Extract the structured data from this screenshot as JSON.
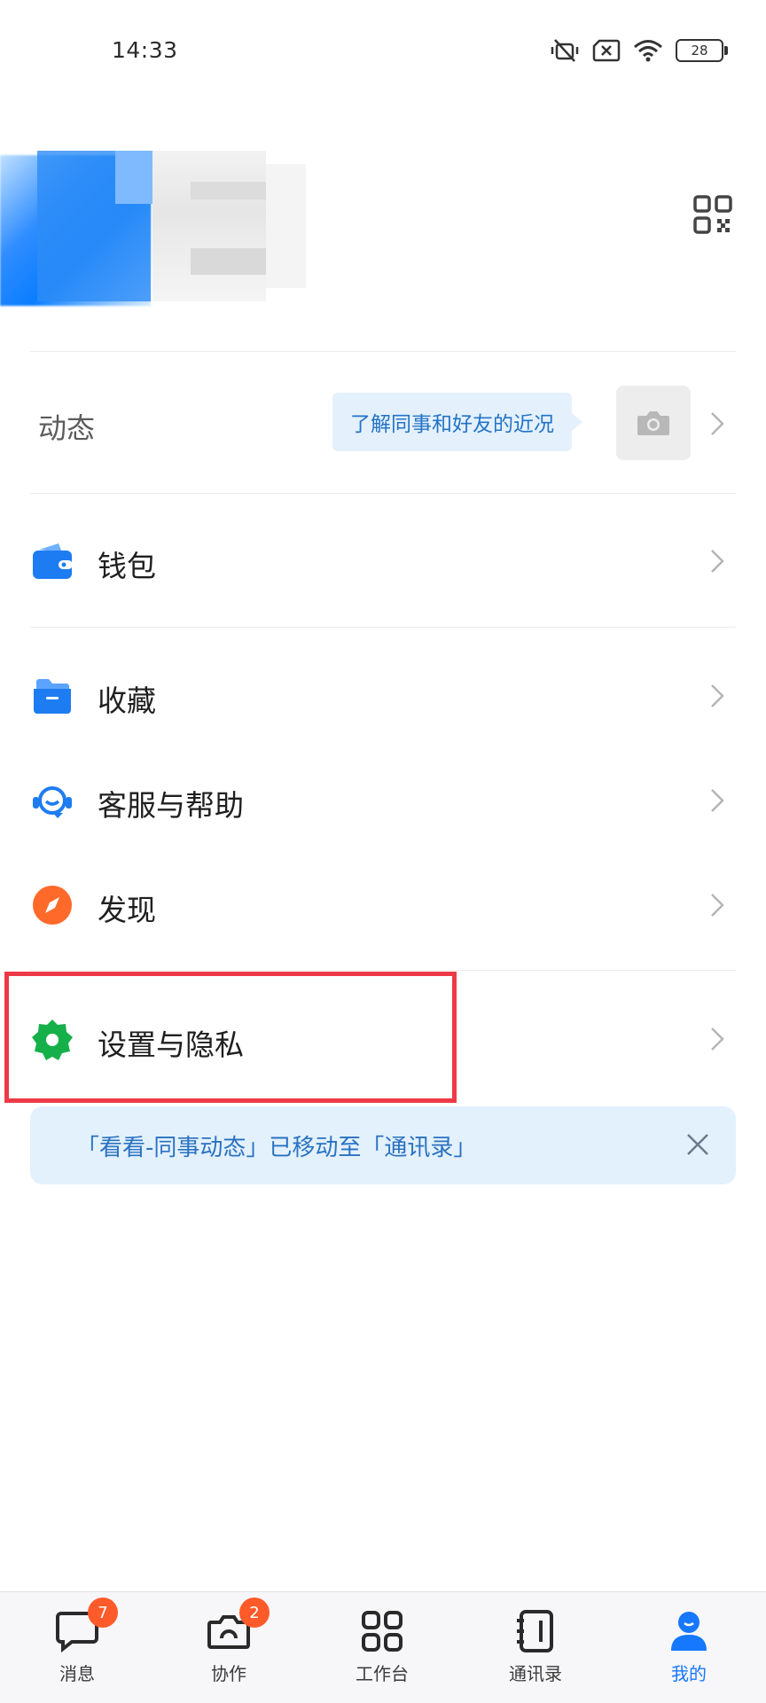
{
  "status_bar": {
    "time": "14:33",
    "battery": "28"
  },
  "feed": {
    "label": "动态",
    "tooltip": "了解同事和好友的近况"
  },
  "menu": {
    "wallet": "钱包",
    "favorites": "收藏",
    "support": "客服与帮助",
    "discover": "发现",
    "settings": "设置与隐私"
  },
  "notice": {
    "text": "「看看-同事动态」已移动至「通讯录」"
  },
  "tabbar": {
    "tabs": [
      {
        "label": "消息",
        "badge": "7"
      },
      {
        "label": "协作",
        "badge": "2"
      },
      {
        "label": "工作台"
      },
      {
        "label": "通讯录"
      },
      {
        "label": "我的"
      }
    ]
  },
  "colors": {
    "accent": "#1677ff",
    "highlight": "#ee3a48",
    "wallet": "#1e7cf2",
    "support": "#1e7cf2",
    "discover": "#ff6a2b",
    "settings": "#16b04a"
  }
}
